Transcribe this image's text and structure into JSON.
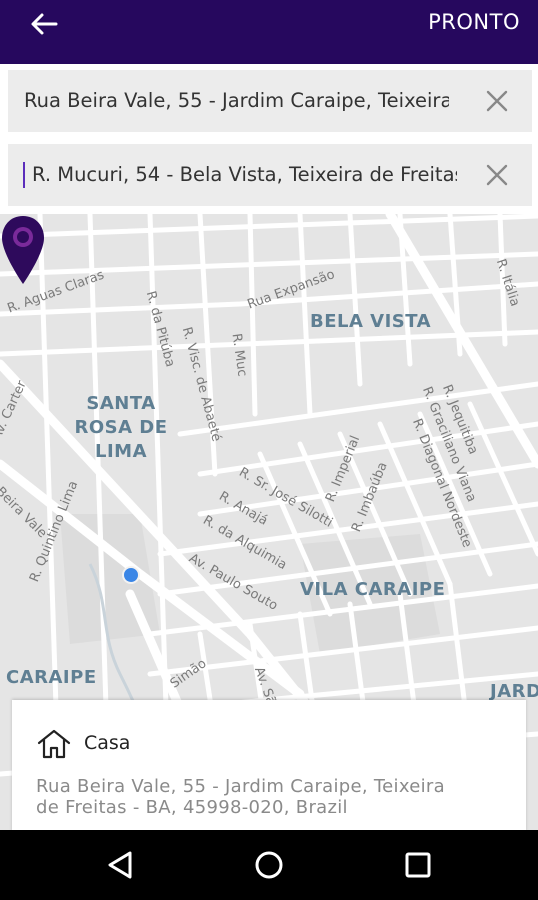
{
  "header": {
    "done_label": "PRONTO",
    "back_icon": "arrow-left-icon"
  },
  "search": {
    "origin_value": "Rua Beira Vale, 55 - Jardim Caraipe, Teixeira",
    "destination_value": "R. Mucuri, 54 - Bela Vista, Teixeira de Freitas",
    "clear_icon": "close-icon"
  },
  "map": {
    "areas": [
      "BELA VISTA",
      "SANTA ROSA DE LIMA",
      "VILA CARAIPE",
      "CARAIPE",
      "JARD"
    ],
    "streets": [
      "R. Aguas Claras",
      "R. da Pitúba",
      "R. Visc. de Abaeté",
      "R. Muc",
      "Rua Expansão",
      "R. Itália",
      "Av. Carter",
      "Beira Vale",
      "R. Quintino Lima",
      "R. Sr. José Silotti",
      "R. Anajá",
      "R. da Alquimia",
      "Av. Paulo Souto",
      "R. Imperial",
      "R. Imbaúba",
      "R. Jequitiba",
      "R. Graciliano Viana",
      "R. Diagonal Nordeste",
      "Av. São",
      "Simão"
    ],
    "pin_color": "#2e0a5c",
    "location_color": "#3a86e6"
  },
  "saved_place": {
    "icon": "home-icon",
    "title": "Casa",
    "address_line1": "Rua Beira Vale, 55 - Jardim Caraipe, Teixeira",
    "address_line2": "de Freitas - BA, 45998-020, Brazil"
  },
  "colors": {
    "header_bg": "#26085e",
    "accent": "#5b2dbb"
  }
}
